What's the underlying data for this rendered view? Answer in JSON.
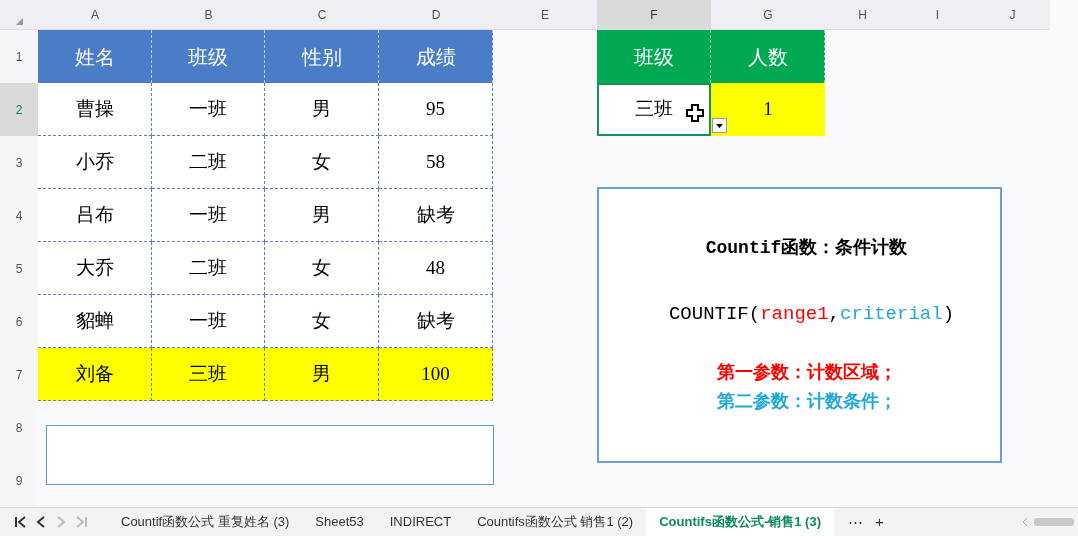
{
  "column_headers": [
    {
      "label": "A",
      "selected": false
    },
    {
      "label": "B",
      "selected": false
    },
    {
      "label": "C",
      "selected": false
    },
    {
      "label": "D",
      "selected": false
    },
    {
      "label": "E",
      "selected": false
    },
    {
      "label": "F",
      "selected": true
    },
    {
      "label": "G",
      "selected": false
    },
    {
      "label": "H",
      "selected": false
    },
    {
      "label": "I",
      "selected": false
    },
    {
      "label": "J",
      "selected": false
    }
  ],
  "row_headers": [
    {
      "label": "1",
      "selected": false
    },
    {
      "label": "2",
      "selected": true
    },
    {
      "label": "3",
      "selected": false
    },
    {
      "label": "4",
      "selected": false
    },
    {
      "label": "5",
      "selected": false
    },
    {
      "label": "6",
      "selected": false
    },
    {
      "label": "7",
      "selected": false
    },
    {
      "label": "8",
      "selected": false
    },
    {
      "label": "9",
      "selected": false
    }
  ],
  "score_table": {
    "columns": [
      "姓名",
      "班级",
      "性别",
      "成绩"
    ],
    "rows": [
      {
        "cells": [
          "曹操",
          "一班",
          "男",
          "95"
        ],
        "highlighted": false
      },
      {
        "cells": [
          "小乔",
          "二班",
          "女",
          "58"
        ],
        "highlighted": false
      },
      {
        "cells": [
          "吕布",
          "一班",
          "男",
          "缺考"
        ],
        "highlighted": false
      },
      {
        "cells": [
          "大乔",
          "二班",
          "女",
          "48"
        ],
        "highlighted": false
      },
      {
        "cells": [
          "貂蝉",
          "一班",
          "女",
          "缺考"
        ],
        "highlighted": false
      },
      {
        "cells": [
          "刘备",
          "三班",
          "男",
          "100"
        ],
        "highlighted": true
      }
    ]
  },
  "count_table": {
    "columns": [
      "班级",
      "人数"
    ],
    "criteria": {
      "value": "三班",
      "selected": true
    },
    "result": "1"
  },
  "note_box": {
    "title": "Countif函数：条件计数",
    "formula": [
      {
        "text": "COUNTIF(",
        "color": "#000000"
      },
      {
        "text": "range1",
        "color": "#ff0000"
      },
      {
        "text": ",",
        "color": "#000000"
      },
      {
        "text": "criterial",
        "color": "#1fa8d8"
      },
      {
        "text": ")",
        "color": "#000000"
      }
    ],
    "notes": [
      {
        "text": "第一参数：计数区域；",
        "color": "#ff0000"
      },
      {
        "text": "第二参数：计数条件；",
        "color": "#1fa8d8"
      }
    ]
  },
  "sheet_tabs": [
    {
      "label": "Countif函数公式 重复姓名 (3)",
      "selected": false
    },
    {
      "label": "Sheet53",
      "selected": false
    },
    {
      "label": "INDIRECT",
      "selected": false
    },
    {
      "label": "Countifs函数公式 销售1 (2)",
      "selected": false
    },
    {
      "label": "Countifs函数公式-销售1 (3)",
      "selected": true
    }
  ],
  "tab_nav": [
    {
      "kind": "first",
      "disabled": false
    },
    {
      "kind": "prev",
      "disabled": false
    },
    {
      "kind": "next",
      "disabled": true
    },
    {
      "kind": "last",
      "disabled": true
    }
  ],
  "tab_actions": [
    "⋯",
    "+"
  ]
}
